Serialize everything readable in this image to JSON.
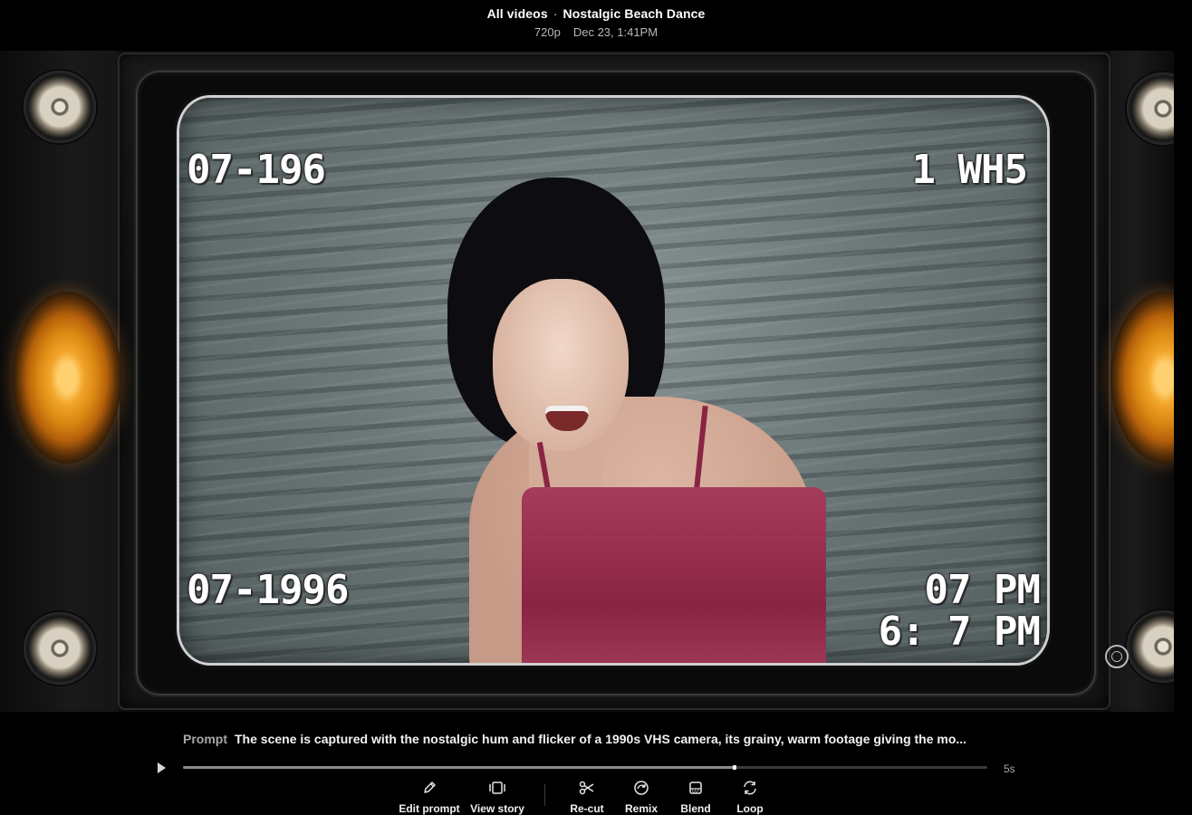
{
  "header": {
    "breadcrumb_root": "All videos",
    "separator": "·",
    "title": "Nostalgic Beach Dance",
    "resolution": "720p",
    "created": "Dec 23, 1:41PM"
  },
  "video": {
    "osd_top_left": "07-196",
    "osd_top_right": "1 WH5",
    "osd_bottom_left": "07-1996",
    "osd_bottom_right_1": "07 PM",
    "osd_bottom_right_2": "6: 7 PM"
  },
  "prompt": {
    "label": "Prompt",
    "text": "The scene is captured with the nostalgic hum and flicker of a 1990s VHS camera, its grainy, warm footage giving the mo..."
  },
  "player": {
    "progress": 0.686,
    "duration_label": "5s"
  },
  "toolbar": {
    "edit_prompt": "Edit prompt",
    "view_story": "View story",
    "recut": "Re-cut",
    "remix": "Remix",
    "blend": "Blend",
    "loop": "Loop"
  },
  "icons": {
    "edit_prompt": "pencil-icon",
    "view_story": "storyboard-icon",
    "recut": "scissors-icon",
    "remix": "remix-icon",
    "blend": "blend-icon",
    "loop": "loop-icon",
    "watermark": "openai-logo-icon",
    "play": "play-icon"
  },
  "colors": {
    "background": "#000000",
    "text_primary": "#ffffff",
    "text_secondary": "#b7b7b7",
    "progress_track": "#3a3a3a",
    "dress": "#8a2444",
    "lamp": "#f2a52a"
  }
}
